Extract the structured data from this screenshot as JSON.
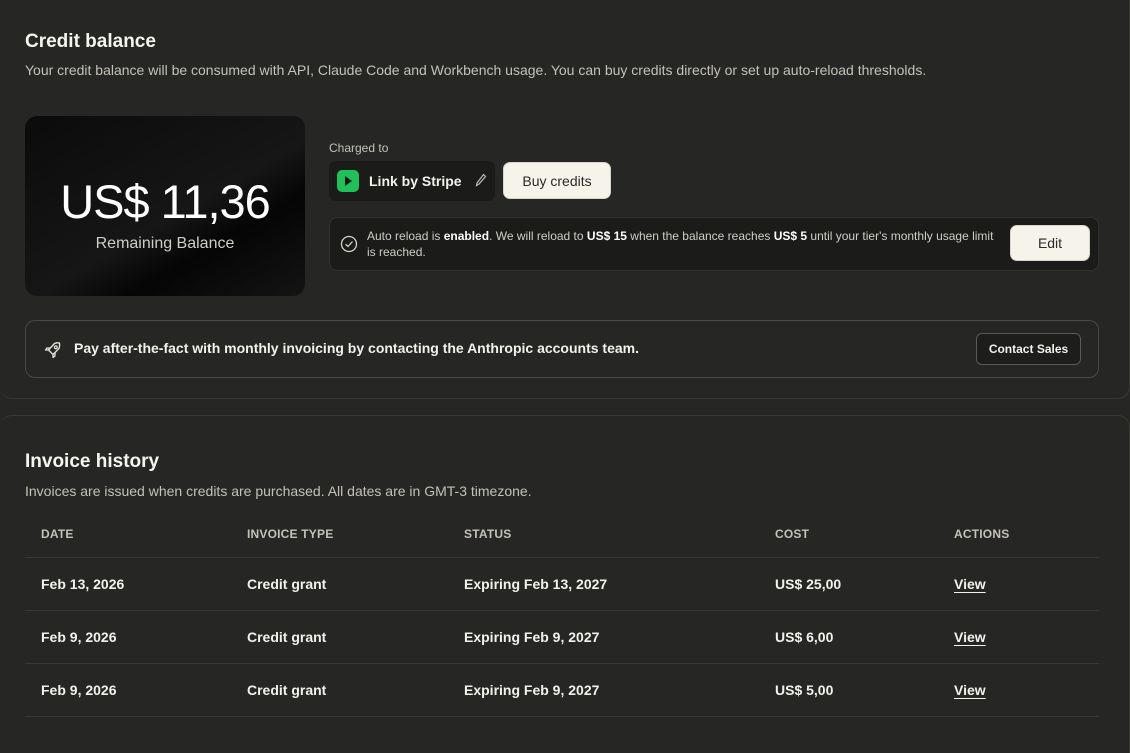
{
  "credit": {
    "title": "Credit balance",
    "subtitle": "Your credit balance will be consumed with API, Claude Code and Workbench usage. You can buy credits directly or set up auto-reload thresholds.",
    "balance_amount": "US$ 11,36",
    "balance_label": "Remaining Balance",
    "charged_to_label": "Charged to",
    "payment_method": "Link by Stripe",
    "buy_button": "Buy credits",
    "auto_reload": {
      "t1": "Auto reload is ",
      "b1": "enabled",
      "t2": ". We will reload to ",
      "b2": "US$ 15",
      "t3": " when the balance reaches ",
      "b3": "US$ 5",
      "t4": " until your tier's monthly usage limit is reached."
    },
    "edit_button": "Edit",
    "sales_text": "Pay after-the-fact with monthly invoicing by contacting the Anthropic accounts team.",
    "contact_button": "Contact Sales"
  },
  "invoices": {
    "title": "Invoice history",
    "subtitle": "Invoices are issued when credits are purchased. All dates are in GMT-3 timezone.",
    "columns": [
      "DATE",
      "INVOICE TYPE",
      "STATUS",
      "COST",
      "ACTIONS"
    ],
    "rows": [
      {
        "date": "Feb 13, 2026",
        "type": "Credit grant",
        "status": "Expiring Feb 13, 2027",
        "cost": "US$ 25,00",
        "action": "View"
      },
      {
        "date": "Feb 9, 2026",
        "type": "Credit grant",
        "status": "Expiring Feb 9, 2027",
        "cost": "US$ 6,00",
        "action": "View"
      },
      {
        "date": "Feb 9, 2026",
        "type": "Credit grant",
        "status": "Expiring Feb 9, 2027",
        "cost": "US$ 5,00",
        "action": "View"
      }
    ]
  },
  "colors": {
    "background": "#262624",
    "stripe_green": "#22c05a",
    "button_light": "#f5f3ea"
  },
  "icons": {
    "payment": "stripe-logo-icon",
    "edit": "pencil-icon",
    "status": "check-circle-icon",
    "sales": "rocket-icon"
  }
}
